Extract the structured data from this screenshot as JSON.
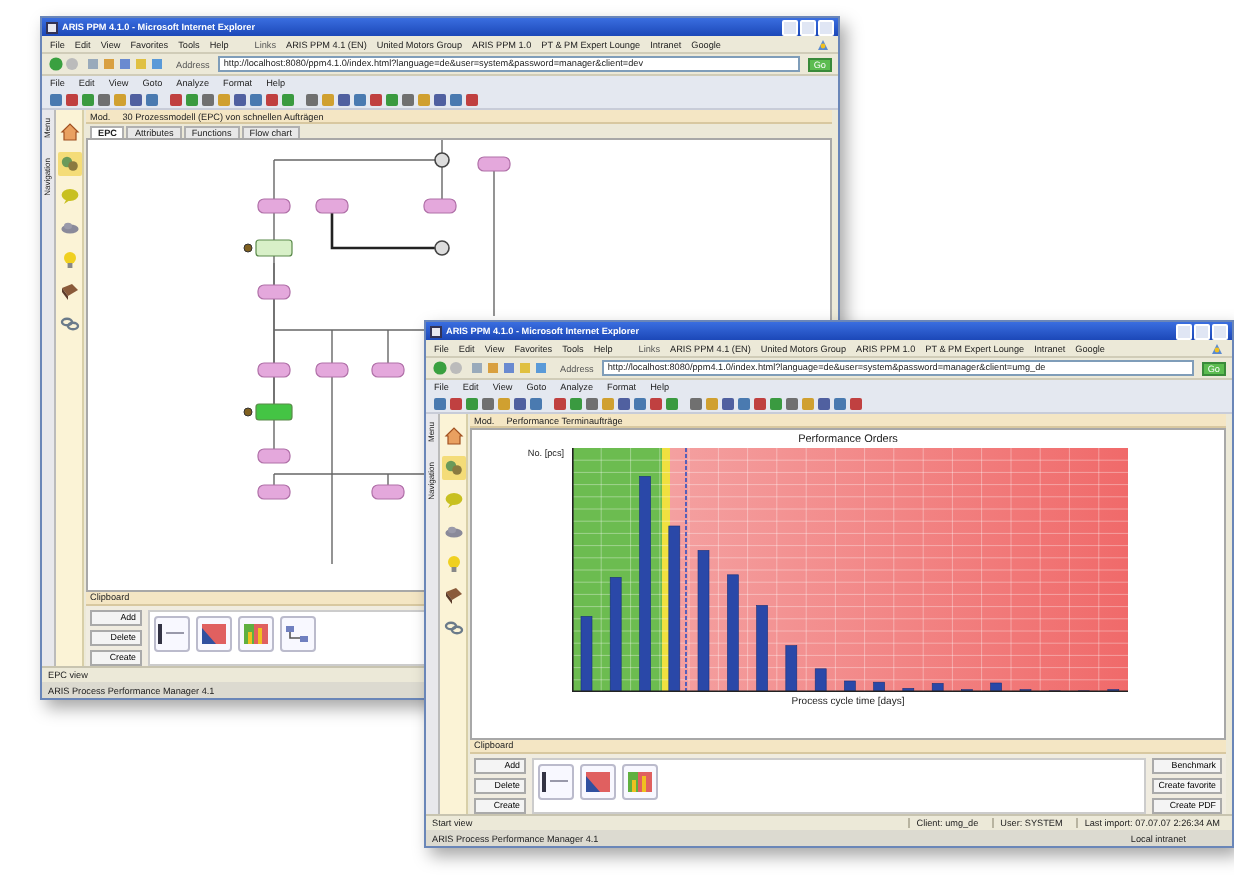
{
  "windows": [
    {
      "kind": "diagram",
      "title": "ARIS PPM 4.1.0 - Microsoft Internet Explorer",
      "menu": [
        "File",
        "Edit",
        "View",
        "Favorites",
        "Tools",
        "Help"
      ],
      "links_label": "Links",
      "links": [
        "ARIS PPM 4.1 (EN)",
        "United Motors Group",
        "ARIS PPM 1.0",
        "PT & PM Expert Lounge",
        "Intranet",
        "Google"
      ],
      "address_label": "Address",
      "address": "http://localhost:8080/ppm4.1.0/index.html?language=de&user=system&password=manager&client=dev",
      "go": "Go",
      "app_menu": [
        "File",
        "Edit",
        "View",
        "Goto",
        "Analyze",
        "Format",
        "Help"
      ],
      "side_tabs": [
        "Menu",
        "Navigation"
      ],
      "nav_icons": [
        {
          "kind": "house",
          "selected": false
        },
        {
          "kind": "gears",
          "selected": true
        },
        {
          "kind": "bubble",
          "selected": false
        },
        {
          "kind": "cloud",
          "selected": false
        },
        {
          "kind": "bulb",
          "selected": false
        },
        {
          "kind": "book",
          "selected": false
        },
        {
          "kind": "chain",
          "selected": false
        }
      ],
      "view_selector": "Mod.",
      "header": "30 Prozessmodell (EPC) von schnellen Aufträgen",
      "tabs": [
        {
          "label": "EPC",
          "selected": true
        },
        {
          "label": "Attributes",
          "selected": false
        },
        {
          "label": "Functions",
          "selected": false
        },
        {
          "label": "Flow chart",
          "selected": false
        }
      ],
      "clipboard": {
        "title": "Clipboard",
        "buttons": [
          "Add",
          "Delete",
          "Create"
        ],
        "thumbnails": [
          {
            "kind": "table"
          },
          {
            "kind": "area"
          },
          {
            "kind": "bars"
          },
          {
            "kind": "flow"
          }
        ]
      },
      "status": "EPC view",
      "taskbar": "ARIS Process Performance Manager 4.1"
    },
    {
      "kind": "chart",
      "title": "ARIS PPM 4.1.0 - Microsoft Internet Explorer",
      "menu": [
        "File",
        "Edit",
        "View",
        "Favorites",
        "Tools",
        "Help"
      ],
      "links_label": "Links",
      "links": [
        "ARIS PPM 4.1 (EN)",
        "United Motors Group",
        "ARIS PPM 1.0",
        "PT & PM Expert Lounge",
        "Intranet",
        "Google"
      ],
      "address_label": "Address",
      "address": "http://localhost:8080/ppm4.1.0/index.html?language=de&user=system&password=manager&client=umg_de",
      "go": "Go",
      "app_menu": [
        "File",
        "Edit",
        "View",
        "Goto",
        "Analyze",
        "Format",
        "Help"
      ],
      "side_tabs": [
        "Menu",
        "Navigation"
      ],
      "nav_icons": [
        {
          "kind": "house",
          "selected": false
        },
        {
          "kind": "gears",
          "selected": true
        },
        {
          "kind": "bubble",
          "selected": false
        },
        {
          "kind": "cloud",
          "selected": false
        },
        {
          "kind": "bulb",
          "selected": false
        },
        {
          "kind": "book",
          "selected": false
        },
        {
          "kind": "chain",
          "selected": false
        }
      ],
      "view_selector": "Mod.",
      "header": "Performance Terminaufträge",
      "chart_title": "Performance Orders",
      "ylabel": "No. [pcs]",
      "xlabel": "Process cycle time [days]",
      "clipboard": {
        "title": "Clipboard",
        "buttons": [
          "Add",
          "Delete",
          "Create"
        ],
        "thumbnails": [
          {
            "kind": "table"
          },
          {
            "kind": "area"
          },
          {
            "kind": "bars"
          }
        ]
      },
      "actions": [
        "Benchmark",
        "Create favorite",
        "Create PDF"
      ],
      "status": "Start view",
      "status_fields": [
        "Client: umg_de",
        "User: SYSTEM",
        "Last import: 07.07.07 2:26:34 AM"
      ],
      "taskbar": "ARIS Process Performance Manager 4.1",
      "zone": "Local intranet"
    }
  ]
}
